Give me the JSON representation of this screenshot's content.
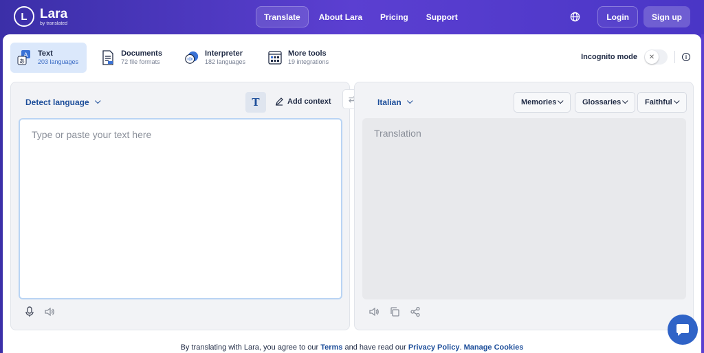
{
  "brand": {
    "name": "Lara",
    "sub": "by translated",
    "mark": "L"
  },
  "nav": [
    "Translate",
    "About Lara",
    "Pricing",
    "Support"
  ],
  "header": {
    "login": "Login",
    "signup": "Sign up"
  },
  "tools": [
    {
      "label": "Text",
      "sub": "203 languages",
      "icon": "text-translate-icon"
    },
    {
      "label": "Documents",
      "sub": "72 file formats",
      "icon": "document-icon"
    },
    {
      "label": "Interpreter",
      "sub": "182 languages",
      "icon": "interpreter-icon"
    },
    {
      "label": "More tools",
      "sub": "19 integrations",
      "icon": "grid-icon"
    }
  ],
  "incognito": {
    "label": "Incognito mode",
    "toggle_glyph": "✕",
    "info_glyph": "i"
  },
  "source": {
    "language": "Detect language",
    "format_glyph": "T",
    "add_context": "Add context",
    "placeholder": "Type or paste your text here"
  },
  "target": {
    "language": "Italian",
    "memories": "Memories",
    "glossaries": "Glossaries",
    "style": "Faithful",
    "placeholder": "Translation"
  },
  "swap_glyph": "⇄",
  "footer": {
    "prefix": "By translating with Lara, you agree to our",
    "terms": "Terms",
    "middle": "and have read our",
    "privacy": "Privacy Policy",
    "sep": ".",
    "cookies": "Manage Cookies"
  },
  "colors": {
    "accent": "#1d4e9a",
    "header_bg": "#4a36c6",
    "active_tool": "#dbe8fb"
  }
}
